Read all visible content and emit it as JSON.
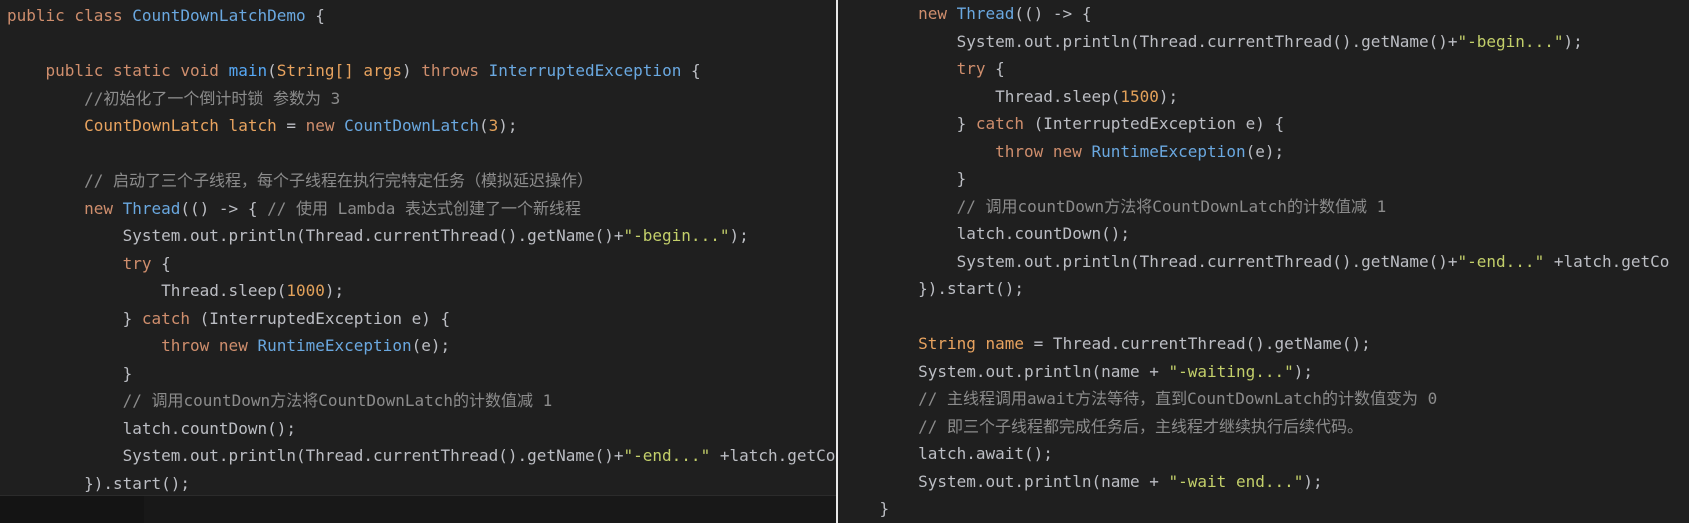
{
  "left": {
    "lines": [
      [
        {
          "c": "kw",
          "t": "public class "
        },
        {
          "c": "cls",
          "t": "CountDownLatchDemo"
        },
        {
          "c": "punc",
          "t": " {"
        }
      ],
      [],
      [
        {
          "c": "punc",
          "t": "    "
        },
        {
          "c": "kw",
          "t": "public static void "
        },
        {
          "c": "fn",
          "t": "main"
        },
        {
          "c": "punc",
          "t": "("
        },
        {
          "c": "var",
          "t": "String[] args"
        },
        {
          "c": "punc",
          "t": ") "
        },
        {
          "c": "kw",
          "t": "throws "
        },
        {
          "c": "cls",
          "t": "InterruptedException"
        },
        {
          "c": "punc",
          "t": " {"
        }
      ],
      [
        {
          "c": "punc",
          "t": "        "
        },
        {
          "c": "cmt",
          "t": "//初始化了一个倒计时锁 参数为 3"
        }
      ],
      [
        {
          "c": "punc",
          "t": "        "
        },
        {
          "c": "var",
          "t": "CountDownLatch latch"
        },
        {
          "c": "punc",
          "t": " = "
        },
        {
          "c": "kw",
          "t": "new "
        },
        {
          "c": "cls",
          "t": "CountDownLatch"
        },
        {
          "c": "punc",
          "t": "("
        },
        {
          "c": "num",
          "t": "3"
        },
        {
          "c": "punc",
          "t": ");"
        }
      ],
      [],
      [
        {
          "c": "punc",
          "t": "        "
        },
        {
          "c": "cmt",
          "t": "// 启动了三个子线程，每个子线程在执行完特定任务（模拟延迟操作）"
        }
      ],
      [
        {
          "c": "punc",
          "t": "        "
        },
        {
          "c": "kw",
          "t": "new "
        },
        {
          "c": "cls",
          "t": "Thread"
        },
        {
          "c": "punc",
          "t": "(() -> { "
        },
        {
          "c": "cmt",
          "t": "// 使用 Lambda 表达式创建了一个新线程"
        }
      ],
      [
        {
          "c": "punc",
          "t": "            System.out.println(Thread.currentThread().getName()+"
        },
        {
          "c": "str",
          "t": "\"-begin...\""
        },
        {
          "c": "punc",
          "t": ");"
        }
      ],
      [
        {
          "c": "punc",
          "t": "            "
        },
        {
          "c": "kw",
          "t": "try"
        },
        {
          "c": "punc",
          "t": " {"
        }
      ],
      [
        {
          "c": "punc",
          "t": "                Thread.sleep("
        },
        {
          "c": "num",
          "t": "1000"
        },
        {
          "c": "punc",
          "t": ");"
        }
      ],
      [
        {
          "c": "punc",
          "t": "            } "
        },
        {
          "c": "kw",
          "t": "catch"
        },
        {
          "c": "punc",
          "t": " (InterruptedException e) {"
        }
      ],
      [
        {
          "c": "punc",
          "t": "                "
        },
        {
          "c": "kw",
          "t": "throw new "
        },
        {
          "c": "cls",
          "t": "RuntimeException"
        },
        {
          "c": "punc",
          "t": "(e);"
        }
      ],
      [
        {
          "c": "punc",
          "t": "            }"
        }
      ],
      [
        {
          "c": "punc",
          "t": "            "
        },
        {
          "c": "cmt",
          "t": "// 调用countDown方法将CountDownLatch的计数值减 1"
        }
      ],
      [
        {
          "c": "punc",
          "t": "            latch.countDown();"
        }
      ],
      [
        {
          "c": "punc",
          "t": "            System.out.println(Thread.currentThread().getName()+"
        },
        {
          "c": "str",
          "t": "\"-end...\""
        },
        {
          "c": "punc",
          "t": " +latch.getCou"
        }
      ],
      [
        {
          "c": "punc",
          "t": "        }).start();"
        }
      ]
    ]
  },
  "right": {
    "lines": [
      [
        {
          "c": "punc",
          "t": "        "
        },
        {
          "c": "kw",
          "t": "new "
        },
        {
          "c": "cls",
          "t": "Thread"
        },
        {
          "c": "punc",
          "t": "(() -> {"
        }
      ],
      [
        {
          "c": "punc",
          "t": "            System.out.println(Thread.currentThread().getName()+"
        },
        {
          "c": "str",
          "t": "\"-begin...\""
        },
        {
          "c": "punc",
          "t": ");"
        }
      ],
      [
        {
          "c": "punc",
          "t": "            "
        },
        {
          "c": "kw",
          "t": "try"
        },
        {
          "c": "punc",
          "t": " {"
        }
      ],
      [
        {
          "c": "punc",
          "t": "                Thread.sleep("
        },
        {
          "c": "num",
          "t": "1500"
        },
        {
          "c": "punc",
          "t": ");"
        }
      ],
      [
        {
          "c": "punc",
          "t": "            } "
        },
        {
          "c": "kw",
          "t": "catch"
        },
        {
          "c": "punc",
          "t": " (InterruptedException e) {"
        }
      ],
      [
        {
          "c": "punc",
          "t": "                "
        },
        {
          "c": "kw",
          "t": "throw new "
        },
        {
          "c": "cls",
          "t": "RuntimeException"
        },
        {
          "c": "punc",
          "t": "(e);"
        }
      ],
      [
        {
          "c": "punc",
          "t": "            }"
        }
      ],
      [
        {
          "c": "punc",
          "t": "            "
        },
        {
          "c": "cmt",
          "t": "// 调用countDown方法将CountDownLatch的计数值减 1"
        }
      ],
      [
        {
          "c": "punc",
          "t": "            latch.countDown();"
        }
      ],
      [
        {
          "c": "punc",
          "t": "            System.out.println(Thread.currentThread().getName()+"
        },
        {
          "c": "str",
          "t": "\"-end...\""
        },
        {
          "c": "punc",
          "t": " +latch.getCo"
        }
      ],
      [
        {
          "c": "punc",
          "t": "        }).start();"
        }
      ],
      [],
      [
        {
          "c": "punc",
          "t": "        "
        },
        {
          "c": "var",
          "t": "String name"
        },
        {
          "c": "punc",
          "t": " = Thread.currentThread().getName();"
        }
      ],
      [
        {
          "c": "punc",
          "t": "        System.out.println(name + "
        },
        {
          "c": "str",
          "t": "\"-waiting...\""
        },
        {
          "c": "punc",
          "t": ");"
        }
      ],
      [
        {
          "c": "punc",
          "t": "        "
        },
        {
          "c": "cmt",
          "t": "// 主线程调用await方法等待，直到CountDownLatch的计数值变为 0"
        }
      ],
      [
        {
          "c": "punc",
          "t": "        "
        },
        {
          "c": "cmt",
          "t": "// 即三个子线程都完成任务后，主线程才继续执行后续代码。"
        }
      ],
      [
        {
          "c": "punc",
          "t": "        latch.await();"
        }
      ],
      [
        {
          "c": "punc",
          "t": "        System.out.println(name + "
        },
        {
          "c": "str",
          "t": "\"-wait end...\""
        },
        {
          "c": "punc",
          "t": ");"
        }
      ],
      [
        {
          "c": "punc",
          "t": "    }"
        }
      ]
    ]
  },
  "colors": {
    "background": "#1f1f1f",
    "keyword": "#cf8e6d",
    "class": "#6aa8e0",
    "string": "#c3cf6a",
    "number": "#e2a15a",
    "comment": "#8c8c8c",
    "text": "#bcbec4"
  }
}
